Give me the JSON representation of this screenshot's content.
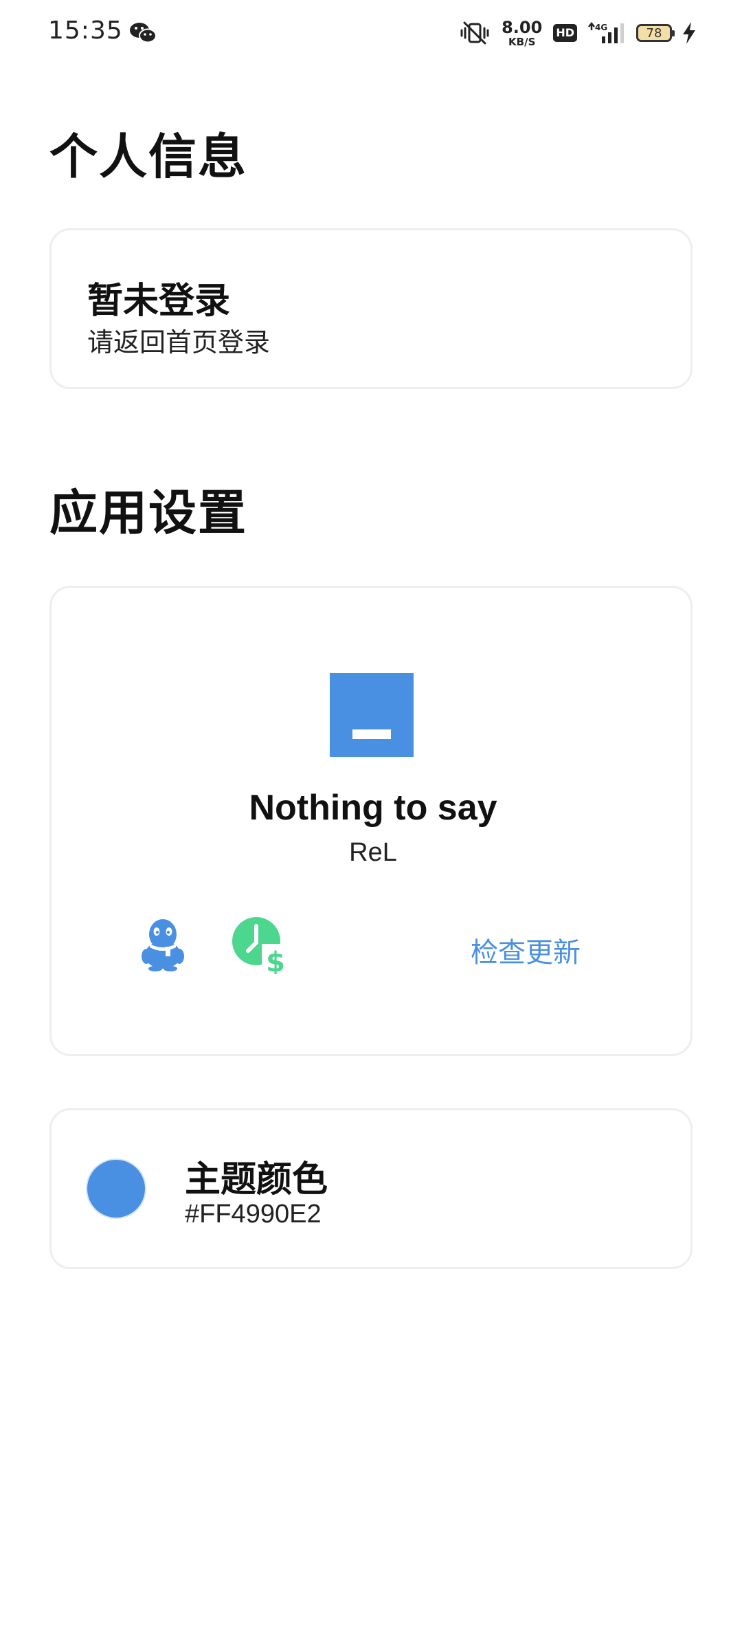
{
  "status_bar": {
    "time": "15:35",
    "net_speed_value": "8.00",
    "net_speed_unit": "KB/S",
    "hd_label": "HD",
    "battery_level": "78",
    "network_type": "4G"
  },
  "personal_section": {
    "title": "个人信息",
    "login_card": {
      "title": "暂未登录",
      "subtitle": "请返回首页登录"
    }
  },
  "settings_section": {
    "title": "应用设置",
    "about_card": {
      "app_name": "Nothing to say",
      "author": "ReL",
      "check_update_label": "检查更新",
      "logo_color": "#4A90E2"
    },
    "theme_card": {
      "title": "主题颜色",
      "value": "#FF4990E2",
      "swatch_color": "#4990E2"
    }
  },
  "icons": {
    "qq": "qq-penguin-icon",
    "donate": "clock-dollar-icon",
    "wechat": "wechat-icon"
  },
  "colors": {
    "accent": "#4A90E2",
    "donate_green": "#4CD68E"
  }
}
